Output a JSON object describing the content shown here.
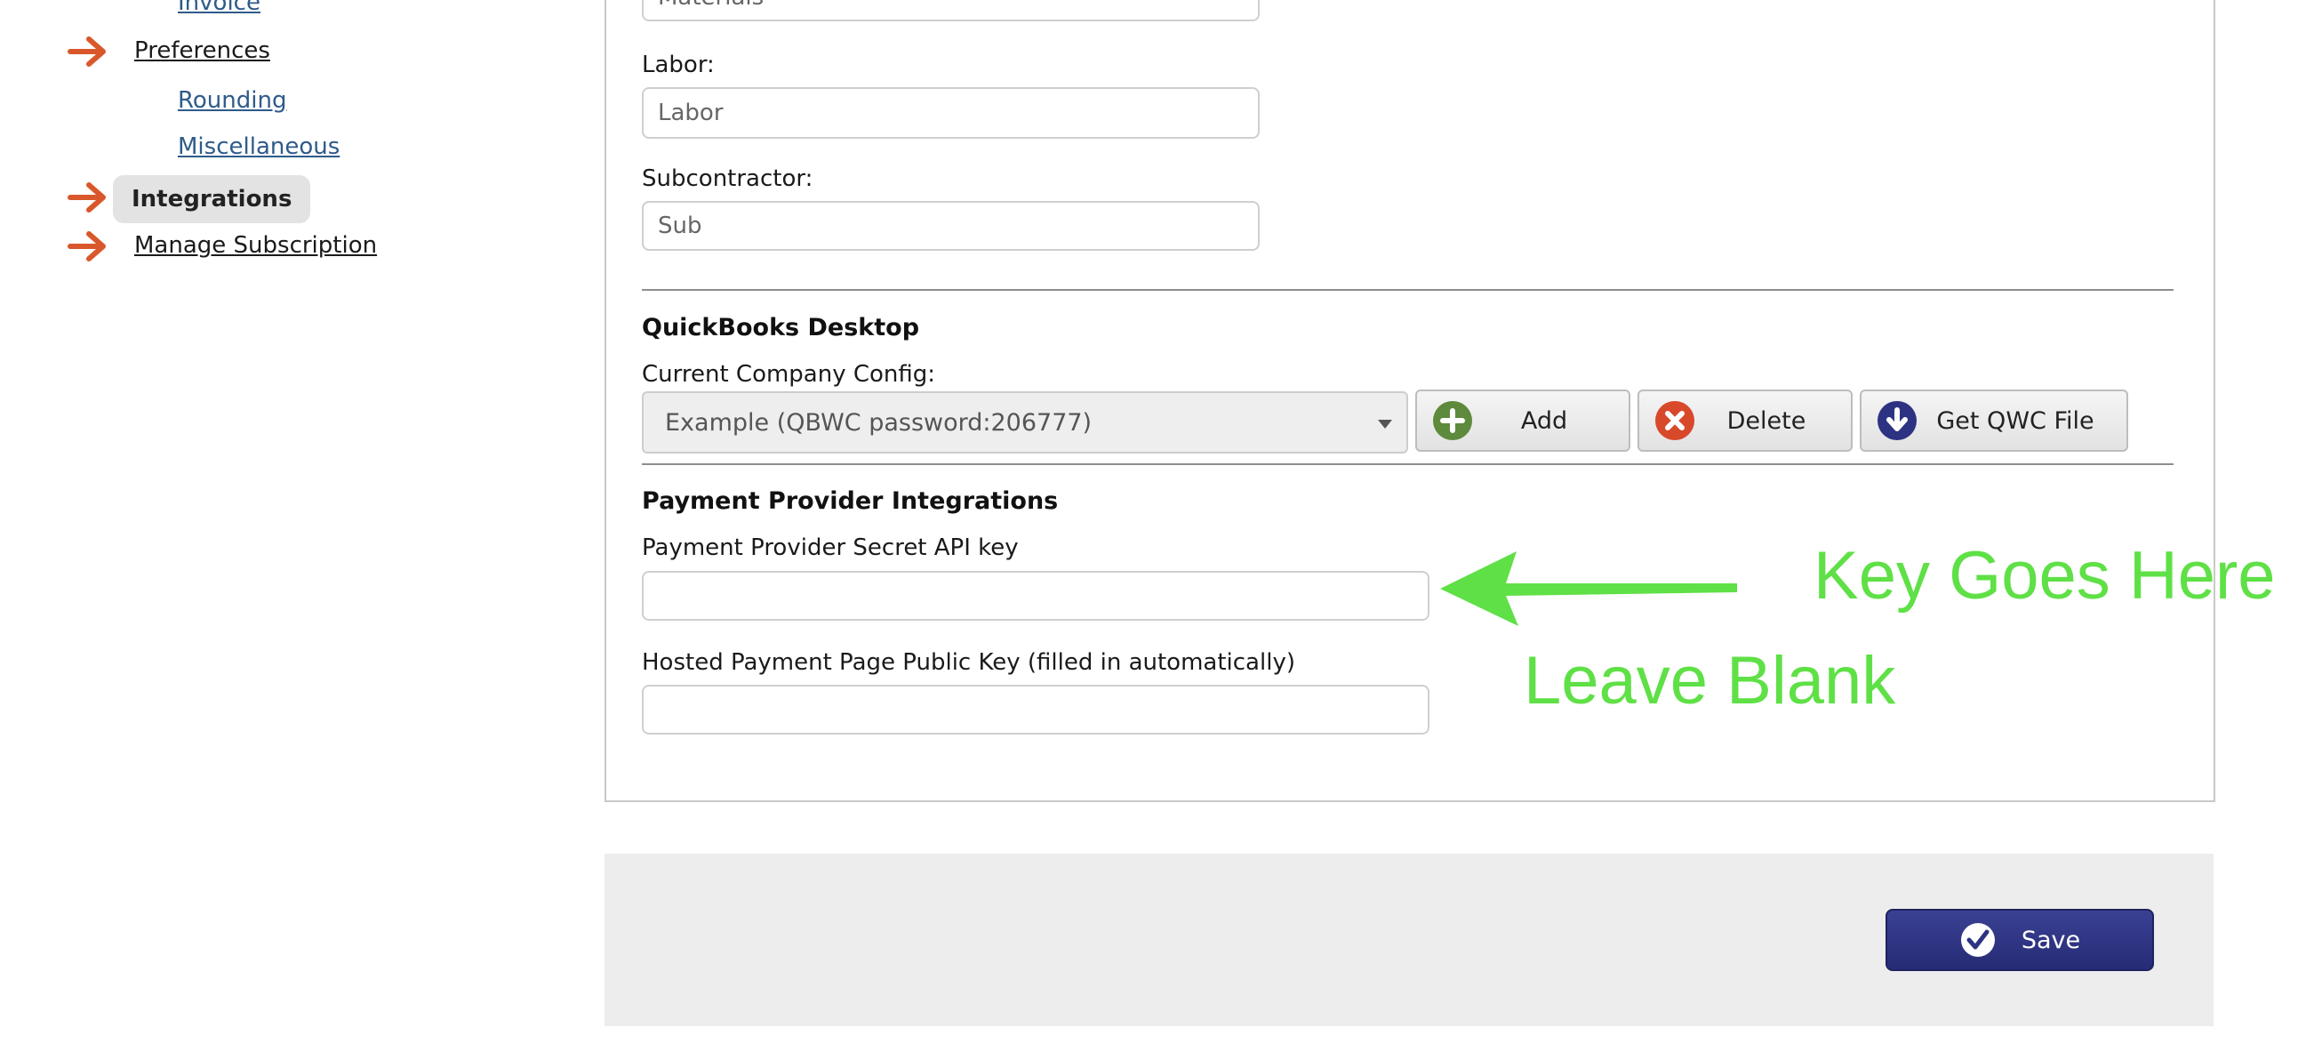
{
  "sidebar": {
    "items": [
      {
        "label": "Invoice"
      },
      {
        "label": "Preferences"
      },
      {
        "label": "Rounding"
      },
      {
        "label": "Miscellaneous"
      },
      {
        "label": "Integrations"
      },
      {
        "label": "Manage Subscription"
      }
    ],
    "arrow_color": "#d9582b"
  },
  "form": {
    "materials": {
      "value": "Materials"
    },
    "labor": {
      "label": "Labor:",
      "value": "Labor"
    },
    "subcontractor": {
      "label": "Subcontractor:",
      "value": "Sub"
    }
  },
  "quickbooks": {
    "title": "QuickBooks Desktop",
    "config_label": "Current Company Config:",
    "config_selected": "Example (QBWC password:206777)",
    "add_label": "Add",
    "delete_label": "Delete",
    "get_qwc_label": "Get QWC File"
  },
  "payment": {
    "title": "Payment Provider Integrations",
    "secret_label": "Payment Provider Secret API key",
    "secret_value": "",
    "public_label": "Hosted Payment Page Public Key (filled in automatically)",
    "public_value": ""
  },
  "footer": {
    "save_label": "Save"
  },
  "annotations": {
    "key_goes_here": "Key Goes Here",
    "leave_blank": "Leave Blank",
    "color": "#5fe046"
  },
  "colors": {
    "accent": "#2d3382",
    "link": "#2f5b8a"
  }
}
